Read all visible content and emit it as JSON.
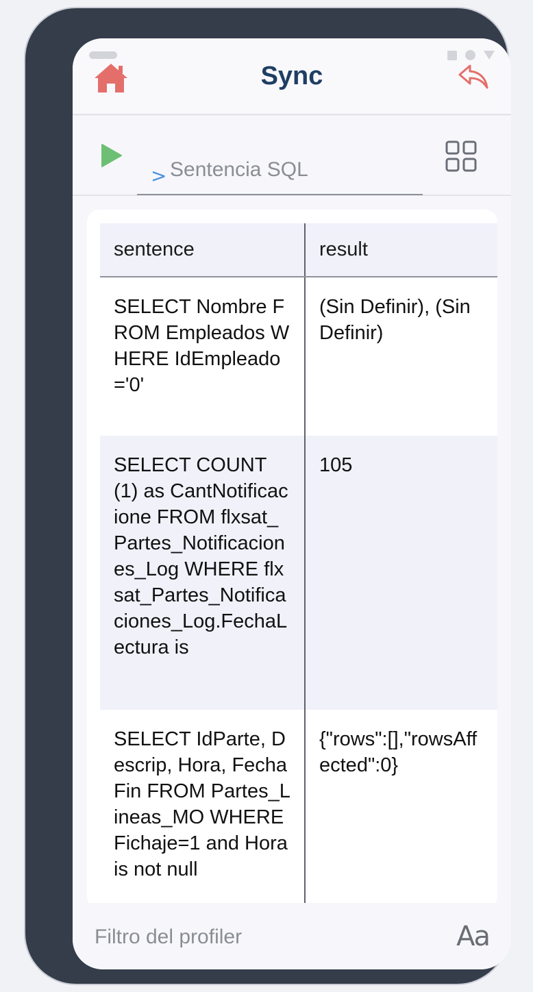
{
  "header": {
    "title": "Sync",
    "home_icon": "home-icon",
    "back_icon": "reply-arrow-icon",
    "accent_color": "#e46f6a",
    "title_color": "#1f3e63"
  },
  "toolbar": {
    "prompt": ">",
    "sql_placeholder": "Sentencia SQL",
    "sql_value": "",
    "run_icon": "play-icon",
    "run_color": "#6dbf73",
    "layout_icon": "grid-icon"
  },
  "table": {
    "columns": [
      "sentence",
      "result"
    ],
    "rows": [
      {
        "sentence": "SELECT Nombre FROM Empleados WHERE IdEmpleado='0'",
        "result": "(Sin Definir), (Sin Definir)"
      },
      {
        "sentence": "SELECT COUNT (1) as CantNotificacione FROM flxsat_Partes_Notificaciones_Log WHERE flxsat_Partes_Notificaciones_Log.FechaLectura is",
        "result": "105"
      },
      {
        "sentence": "SELECT IdParte, Descrip, Hora, FechaFin FROM Partes_Lineas_MO WHERE Fichaje=1 and Hora is not null",
        "result": "{\"rows\":[],\"rowsAffected\":0}"
      }
    ]
  },
  "footer": {
    "filter_placeholder": "Filtro del profiler",
    "font_button": "Aa"
  }
}
